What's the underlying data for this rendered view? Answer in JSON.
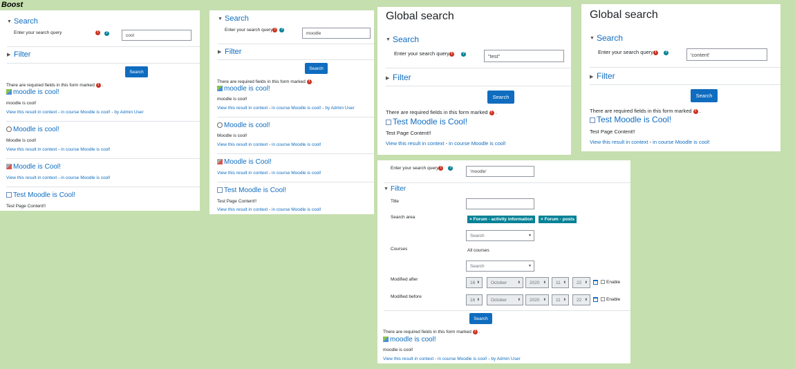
{
  "theme_caption": "Boost",
  "colors": {
    "brand": "#0f6cbf",
    "required": "#ca3120",
    "help": "#008196",
    "badge": "#008196"
  },
  "common": {
    "search_heading": "Search",
    "filter_heading": "Filter",
    "query_label": "Enter your search query",
    "search_button": "Search",
    "required_note": "There are required fields in this form marked",
    "global_search_title": "Global search",
    "view_context": "View this result in context",
    "sep": " - ",
    "in_course": "in course Moodle is cool!",
    "by_admin": "by Admin User"
  },
  "panel1": {
    "query": "cool",
    "results": [
      {
        "title": "moodle is cool!",
        "icon": "forum-icon",
        "snippet": "moodle is cool!",
        "by": true
      },
      {
        "title": "Moodle is cool!",
        "icon": "course-icon",
        "snippet": "Moodle is cool!",
        "by": false
      },
      {
        "title": "Moodle is Cool!",
        "icon": "assign-icon",
        "snippet": "",
        "by": false
      },
      {
        "title": "Test Moodle is Cool!",
        "icon": "page-icon",
        "snippet": "Test Page Content!!",
        "by": false
      }
    ]
  },
  "panel2": {
    "query": "moodle",
    "results": [
      {
        "title": "moodle is cool!",
        "icon": "forum-icon",
        "snippet": "moodle is cool!",
        "by": true
      },
      {
        "title": "Moodle is cool!",
        "icon": "course-icon",
        "snippet": "Moodle is cool!",
        "by": false
      },
      {
        "title": "Moodle is Cool!",
        "icon": "assign-icon",
        "snippet": "",
        "by": false
      },
      {
        "title": "Test Moodle is Cool!",
        "icon": "page-icon",
        "snippet": "Test Page Content!!",
        "by": false
      }
    ]
  },
  "panel3": {
    "query": "\"test\"",
    "result": {
      "title": "Test Moodle is Cool!",
      "icon": "page-icon",
      "snippet": "Test Page Content!!"
    }
  },
  "panel4": {
    "query": "'content'",
    "result": {
      "title": "Test Moodle is Cool!",
      "icon": "page-icon",
      "snippet": "Test Page Content!!"
    }
  },
  "panel5": {
    "query": "'moodle'",
    "title_label": "Title",
    "title_value": "",
    "area_label": "Search area",
    "area_badges": [
      "× Forum - activity information",
      "× Forum - posts"
    ],
    "area_search_placeholder": "Search",
    "courses_label": "Courses",
    "courses_value": "All courses",
    "courses_search_placeholder": "Search",
    "after_label": "Modified after",
    "before_label": "Modified before",
    "date_after": {
      "day": "16",
      "month": "October",
      "year": "2020",
      "hour": "11",
      "minute": "22"
    },
    "date_before": {
      "day": "16",
      "month": "October",
      "year": "2020",
      "hour": "11",
      "minute": "22"
    },
    "enable_label": "Enable",
    "result": {
      "title": "moodle is cool!",
      "icon": "forum-icon",
      "snippet": "moodle is cool!"
    }
  }
}
